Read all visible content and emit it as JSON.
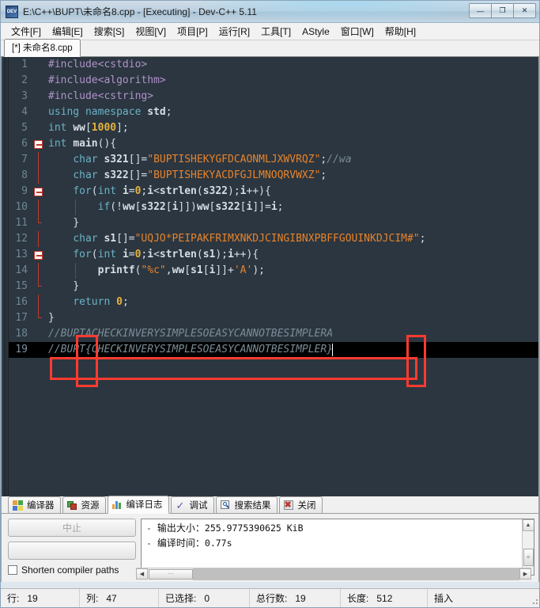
{
  "window": {
    "title": "E:\\C++\\BUPT\\未命名8.cpp - [Executing] - Dev-C++ 5.11",
    "app_icon": "dev-cpp-icon",
    "minimize_label": "—",
    "maximize_label": "❐",
    "close_label": "✕"
  },
  "menu": {
    "items": [
      {
        "label": "文件[F]"
      },
      {
        "label": "编辑[E]"
      },
      {
        "label": "搜索[S]"
      },
      {
        "label": "视图[V]"
      },
      {
        "label": "项目[P]"
      },
      {
        "label": "运行[R]"
      },
      {
        "label": "工具[T]"
      },
      {
        "label": "AStyle"
      },
      {
        "label": "窗口[W]"
      },
      {
        "label": "帮助[H]"
      }
    ]
  },
  "editor_tabs": [
    {
      "label": "[*] 未命名8.cpp",
      "active": true
    }
  ],
  "code": {
    "lines": [
      {
        "n": "1",
        "text": "#include<cstdio>"
      },
      {
        "n": "2",
        "text": "#include<algorithm>"
      },
      {
        "n": "3",
        "text": "#include<cstring>"
      },
      {
        "n": "4",
        "text": "using namespace std;"
      },
      {
        "n": "5",
        "text": "int ww[1000];"
      },
      {
        "n": "6",
        "text": "int main(){"
      },
      {
        "n": "7",
        "text": "    char s321[]=\"BUPTISHEKYGFDCAONMLJXWVRQZ\";//wa"
      },
      {
        "n": "8",
        "text": "    char s322[]=\"BUPTISHEKYACDFGJLMNOQRVWXZ\";"
      },
      {
        "n": "9",
        "text": "    for(int i=0;i<strlen(s322);i++){"
      },
      {
        "n": "10",
        "text": "        if(!ww[s322[i]])ww[s322[i]]=i;"
      },
      {
        "n": "11",
        "text": "    }"
      },
      {
        "n": "12",
        "text": "    char s1[]=\"UQJO*PEIPAKFRIMXNKDJCINGIBNXPBFFGOUINKDJCIM#\";"
      },
      {
        "n": "13",
        "text": "    for(int i=0;i<strlen(s1);i++){"
      },
      {
        "n": "14",
        "text": "        printf(\"%c\",ww[s1[i]]+'A');"
      },
      {
        "n": "15",
        "text": "    }"
      },
      {
        "n": "16",
        "text": "    return 0;"
      },
      {
        "n": "17",
        "text": "}"
      },
      {
        "n": "18",
        "text": "//BUPTACHECKINVERYSIMPLESOEASYCANNOTBESIMPLERA"
      },
      {
        "n": "19",
        "text": "//BUPT{CHECKINVERYSIMPLESOEASYCANNOTBESIMPLER}"
      }
    ],
    "blank_line_count": 8,
    "selected_line": "19",
    "annotations": [
      {
        "name": "redbox-open-brace"
      },
      {
        "name": "redbox-close-brace"
      },
      {
        "name": "redbox-line-19"
      }
    ],
    "theme": {
      "background": "#2b3640",
      "foreground": "#d7dfe6",
      "line_number": "#6f8793",
      "keyword": "#6bb3c7",
      "preprocessor": "#b093c9",
      "string": "#e8832a",
      "number": "#e5b23c",
      "comment": "#7b8c97",
      "selection": "#000000",
      "annotation": "#ff3b30"
    }
  },
  "log_panel": {
    "tabs": [
      {
        "label": "编译器",
        "icon": "compiler-icon",
        "active": false
      },
      {
        "label": "资源",
        "icon": "resources-icon",
        "active": false
      },
      {
        "label": "编译日志",
        "icon": "compile-log-icon",
        "active": true
      },
      {
        "label": "调试",
        "icon": "debug-check-icon",
        "active": false
      },
      {
        "label": "搜索结果",
        "icon": "search-results-icon",
        "active": false
      },
      {
        "label": "关闭",
        "icon": "close-red-icon",
        "active": false
      }
    ],
    "abort_button": "中止",
    "secondary_button": "",
    "shorten_paths_label": "Shorten compiler paths",
    "shorten_paths_checked": false,
    "output": [
      {
        "dash": "-",
        "label": "输出大小：",
        "value": "255.9775390625 KiB"
      },
      {
        "dash": "-",
        "label": "编译时间：",
        "value": "0.77s"
      }
    ]
  },
  "status_bar": {
    "cells": [
      {
        "label": "行:",
        "value": "19"
      },
      {
        "label": "列:",
        "value": "47"
      },
      {
        "label": "已选择:",
        "value": "0"
      },
      {
        "label": "总行数:",
        "value": "19"
      },
      {
        "label": "长度:",
        "value": "512"
      },
      {
        "label": "插入",
        "value": ""
      }
    ]
  }
}
